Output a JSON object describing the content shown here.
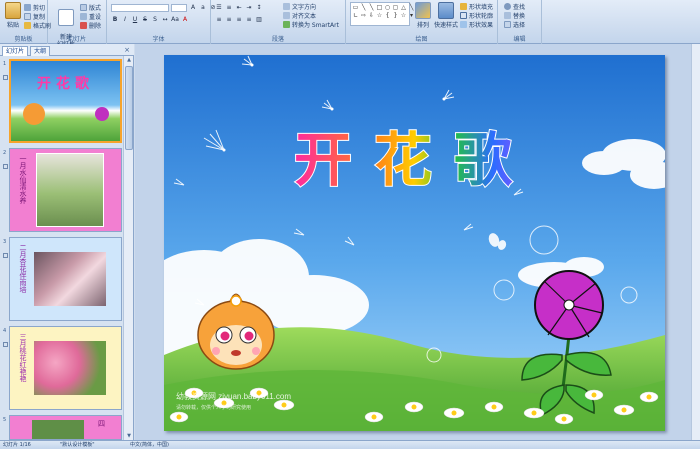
{
  "ribbon": {
    "clipboard": {
      "label": "剪贴板",
      "paste": "粘贴",
      "cut": "剪切",
      "copy": "复制",
      "format_painter": "格式刷"
    },
    "slides": {
      "label": "幻灯片",
      "new_slide": "新建\n幻灯片",
      "layout": "版式",
      "reset": "重设",
      "delete": "删除"
    },
    "font": {
      "label": "字体",
      "font_name": "",
      "font_size": ""
    },
    "paragraph": {
      "label": "段落",
      "text_direction": "文字方向",
      "align_text": "对齐文本",
      "convert_smartart": "转换为 SmartArt"
    },
    "drawing": {
      "label": "绘图",
      "arrange": "排列",
      "quick_styles": "快速样式",
      "shape_fill": "形状填充",
      "shape_outline": "形状轮廓",
      "shape_effects": "形状效果"
    },
    "editing": {
      "label": "编辑",
      "find": "查找",
      "replace": "替换",
      "select": "选择"
    }
  },
  "left_panel": {
    "tabs": [
      "幻灯片",
      "大纲"
    ],
    "close": "×",
    "thumbnails": [
      {
        "number": "1",
        "title": "开花歌",
        "background": "#3f9be0",
        "selected": true
      },
      {
        "number": "2",
        "text": "一月水仙清水养",
        "background": "#f27fd1",
        "selected": false
      },
      {
        "number": "3",
        "text": "二月杏花伴雨培",
        "background": "#cfe6fb",
        "selected": false
      },
      {
        "number": "4",
        "text": "三月桃花红艳艳",
        "background": "#fdf4c2",
        "selected": false
      },
      {
        "number": "5",
        "text": "四",
        "background": "#f27fd1",
        "selected": false
      }
    ]
  },
  "slide": {
    "title": "开花歌",
    "title_colors": [
      "#ff2aa0",
      "#ffcc00",
      "#22c43c",
      "#2c6cff",
      "#a64bff",
      "#ff7f1a"
    ],
    "watermark_main": "幼教资源网 ziyuan.baby611.com",
    "watermark_sub": "请勿转载，仅供个人学习研究使用"
  },
  "status_bar": {
    "slide_info": "幻灯片 1/16",
    "theme": "\"默认设计模板\"",
    "language": "中文(简体，中国)"
  }
}
